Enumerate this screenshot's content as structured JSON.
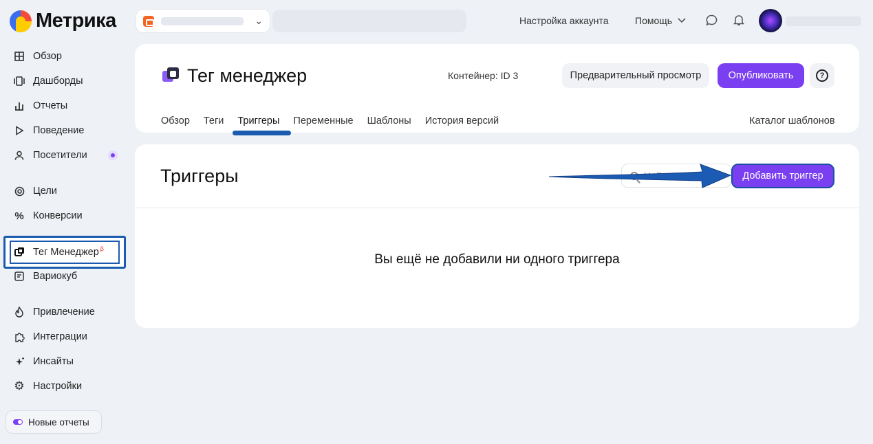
{
  "app": {
    "logo_text": "Метрика"
  },
  "topbar": {
    "account_settings": "Настройка аккаунта",
    "help": "Помощь",
    "chat_icon": "chat-bubble-icon",
    "bell_icon": "bell-icon"
  },
  "sidebar": {
    "items": [
      {
        "label": "Обзор",
        "icon": "grid-icon"
      },
      {
        "label": "Дашборды",
        "icon": "dashboard-icon"
      },
      {
        "label": "Отчеты",
        "icon": "bar-chart-icon"
      },
      {
        "label": "Поведение",
        "icon": "play-icon"
      },
      {
        "label": "Посетители",
        "icon": "user-icon"
      },
      {
        "label": "Цели",
        "icon": "target-icon"
      },
      {
        "label": "Конверсии",
        "icon": "percent-icon"
      },
      {
        "label": "Тег Менеджер",
        "icon": "tag-manager-icon",
        "badge": "β"
      },
      {
        "label": "Вариокуб",
        "icon": "variocube-icon"
      },
      {
        "label": "Привлечение",
        "icon": "flame-icon"
      },
      {
        "label": "Интеграции",
        "icon": "puzzle-icon"
      },
      {
        "label": "Инсайты",
        "icon": "sparkle-icon"
      },
      {
        "label": "Настройки",
        "icon": "gear-icon"
      }
    ],
    "new_reports": "Новые отчеты"
  },
  "header": {
    "title": "Тег менеджер",
    "container_label": "Контейнер: ID 3",
    "preview_button": "Предварительный просмотр",
    "publish_button": "Опубликовать",
    "help_symbol": "?",
    "tabs": [
      "Обзор",
      "Теги",
      "Триггеры",
      "Переменные",
      "Шаблоны",
      "История версий"
    ],
    "active_tab": "Триггеры",
    "catalog_link": "Каталог шаблонов"
  },
  "triggers": {
    "title": "Триггеры",
    "search_placeholder": "Найти",
    "add_button": "Добавить триггер",
    "empty_message": "Вы ещё не добавили ни одного триггера"
  },
  "colors": {
    "accent": "#7b3ff2",
    "highlight": "#1b5baf",
    "background": "#eef1f6"
  }
}
